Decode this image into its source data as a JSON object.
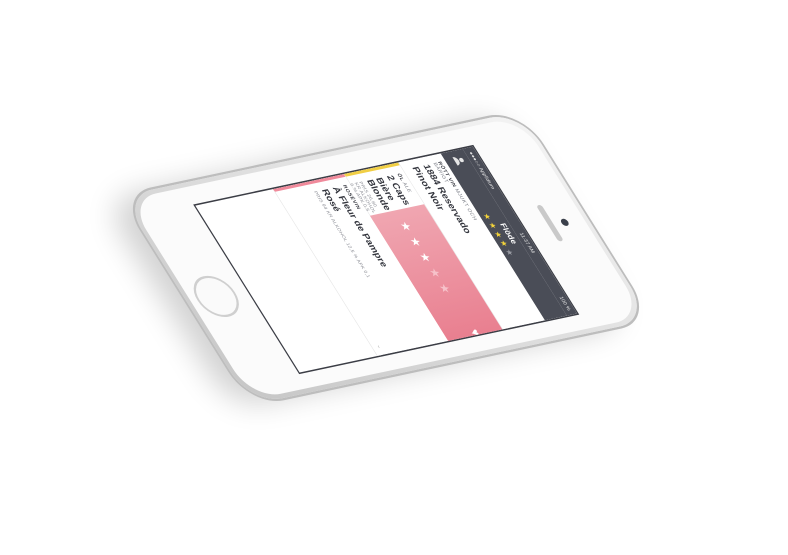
{
  "status": {
    "carrier": "●●●○○ Applidium",
    "time": "11:37 AM",
    "battery": "100 %"
  },
  "nav": {
    "title": "Flöde",
    "rating": {
      "stars": 5,
      "filled": 4
    }
  },
  "cards": [
    {
      "type_bold": "RÖTT VIN",
      "type_rest": "MJUKT OCH",
      "sub": "BÄRIGT",
      "name1": "1884 Reservado",
      "name2": "Pinot Noir"
    },
    {
      "type_bold": "ÖL",
      "type_rest": "ALE",
      "name1": "2 Caps",
      "name2": "Bière Blonde",
      "meta": "PRIS 26,80 KR   ALKOHOL 6 %   APK 0,5"
    },
    {
      "type_bold": "ROSÉVIN",
      "type_rest": "",
      "name1": "À Fleur de Pampre",
      "name2": "Rosé",
      "meta": "PRIS 94 KR   ALKOHOL 12,5 %   APK 0,1"
    }
  ],
  "rating_panel": {
    "stars": 5,
    "filled": 3,
    "heart": "♥"
  },
  "side_card": {
    "type": "RÖTT",
    "name1": "337",
    "name2": "Cabe"
  },
  "colors": {
    "nav": "#4a4d57",
    "star": "#f3d33a",
    "rose": "#e87b8c",
    "accent": "#f1cf45"
  }
}
